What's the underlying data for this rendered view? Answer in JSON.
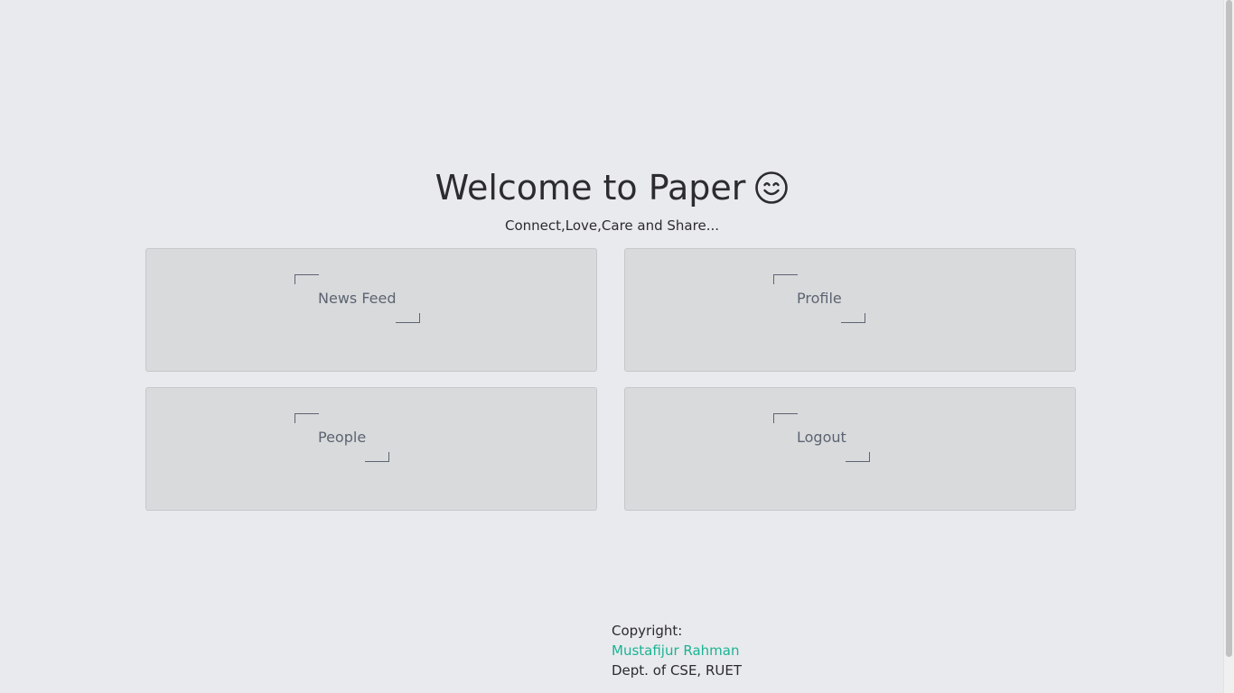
{
  "hero": {
    "title": "Welcome to Paper",
    "icon": "smiley-icon",
    "subtitle": "Connect,Love,Care and Share..."
  },
  "cards": [
    {
      "label": "News Feed"
    },
    {
      "label": "Profile"
    },
    {
      "label": "People"
    },
    {
      "label": "Logout"
    }
  ],
  "footer": {
    "copyright_label": "Copyright:",
    "author": "Mustafijur Rahman",
    "department": "Dept. of CSE, RUET"
  },
  "colors": {
    "background": "#e9eaed",
    "card": "#d9dadc",
    "card_text": "#5c6472",
    "link": "#1ab394"
  }
}
